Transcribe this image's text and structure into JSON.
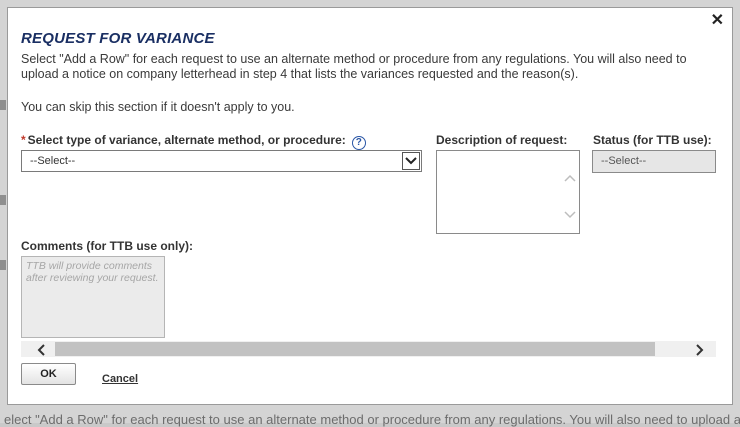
{
  "background": {
    "footer_text": "elect \"Add a Row\" for each request to use an alternate method or procedure from any regulations. You will also need to upload a"
  },
  "modal": {
    "title": "REQUEST FOR VARIANCE",
    "intro": "Select \"Add a Row\" for each request to use an alternate method or procedure from any regulations. You will also need to upload a notice on company letterhead in step 4 that lists the variances requested and the reason(s).",
    "skip_note": "You can skip this section if it doesn't apply to you.",
    "close_glyph": "✕",
    "fields": {
      "variance_type_label": "Select type of variance, alternate method, or procedure:",
      "required_mark": "*",
      "help_glyph": "?",
      "variance_type_value": "--Select--",
      "description_label": "Description of request:",
      "status_label": "Status (for TTB use):",
      "status_value": "--Select--",
      "comments_label": "Comments (for TTB use only):",
      "comments_placeholder": "TTB will provide comments after reviewing your request."
    },
    "buttons": {
      "ok": "OK",
      "cancel": "Cancel"
    }
  }
}
